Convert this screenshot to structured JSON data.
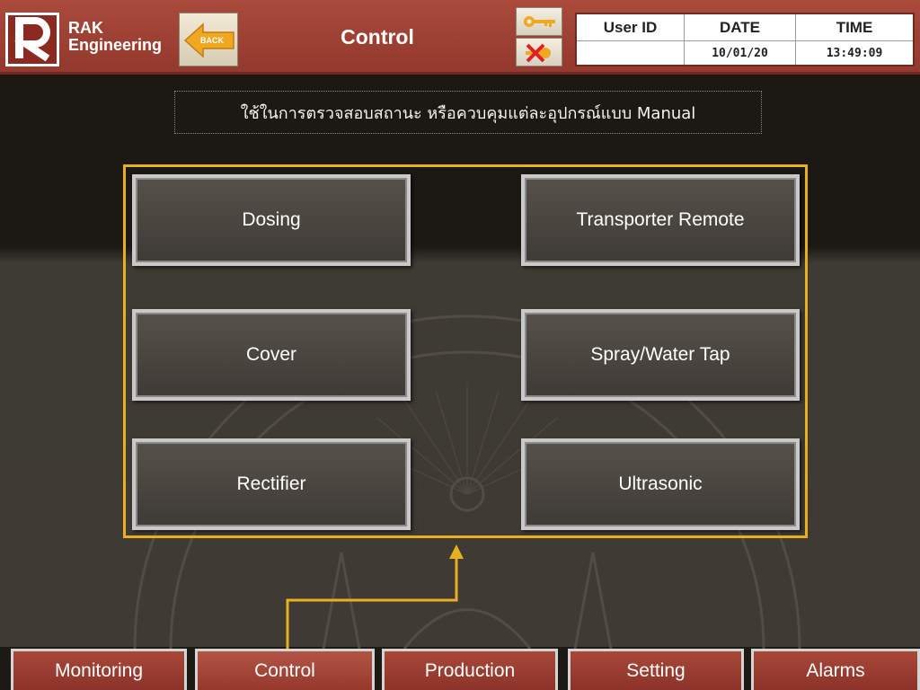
{
  "header": {
    "logo_line1": "RAK",
    "logo_line2": "Engineering",
    "back_label": "BACK",
    "title": "Control",
    "info": {
      "user_id_label": "User ID",
      "user_id_value": "",
      "date_label": "DATE",
      "date_value": "10/01/20",
      "time_label": "TIME",
      "time_value": "13:49:09"
    }
  },
  "instruction": "ใช้ในการตรวจสอบสถานะ หรือควบคุมแต่ละอุปกรณ์แบบ Manual",
  "buttons": {
    "dosing": "Dosing",
    "transporter_remote": "Transporter Remote",
    "cover": "Cover",
    "spray_water_tap": "Spray/Water Tap",
    "rectifier": "Rectifier",
    "ultrasonic": "Ultrasonic"
  },
  "nav": {
    "monitoring": "Monitoring",
    "control": "Control",
    "production": "Production",
    "setting": "Setting",
    "alarms": "Alarms"
  },
  "icons": {
    "back": "arrow-left-icon",
    "login": "key-icon",
    "logout": "key-x-icon",
    "logo": "rak-logo-icon",
    "watermark": "emblem-watermark"
  },
  "colors": {
    "header_red": "#9c3f32",
    "frame_gold": "#e8b020",
    "background_dark": "#1d1915",
    "button_gray": "#4a4640"
  }
}
